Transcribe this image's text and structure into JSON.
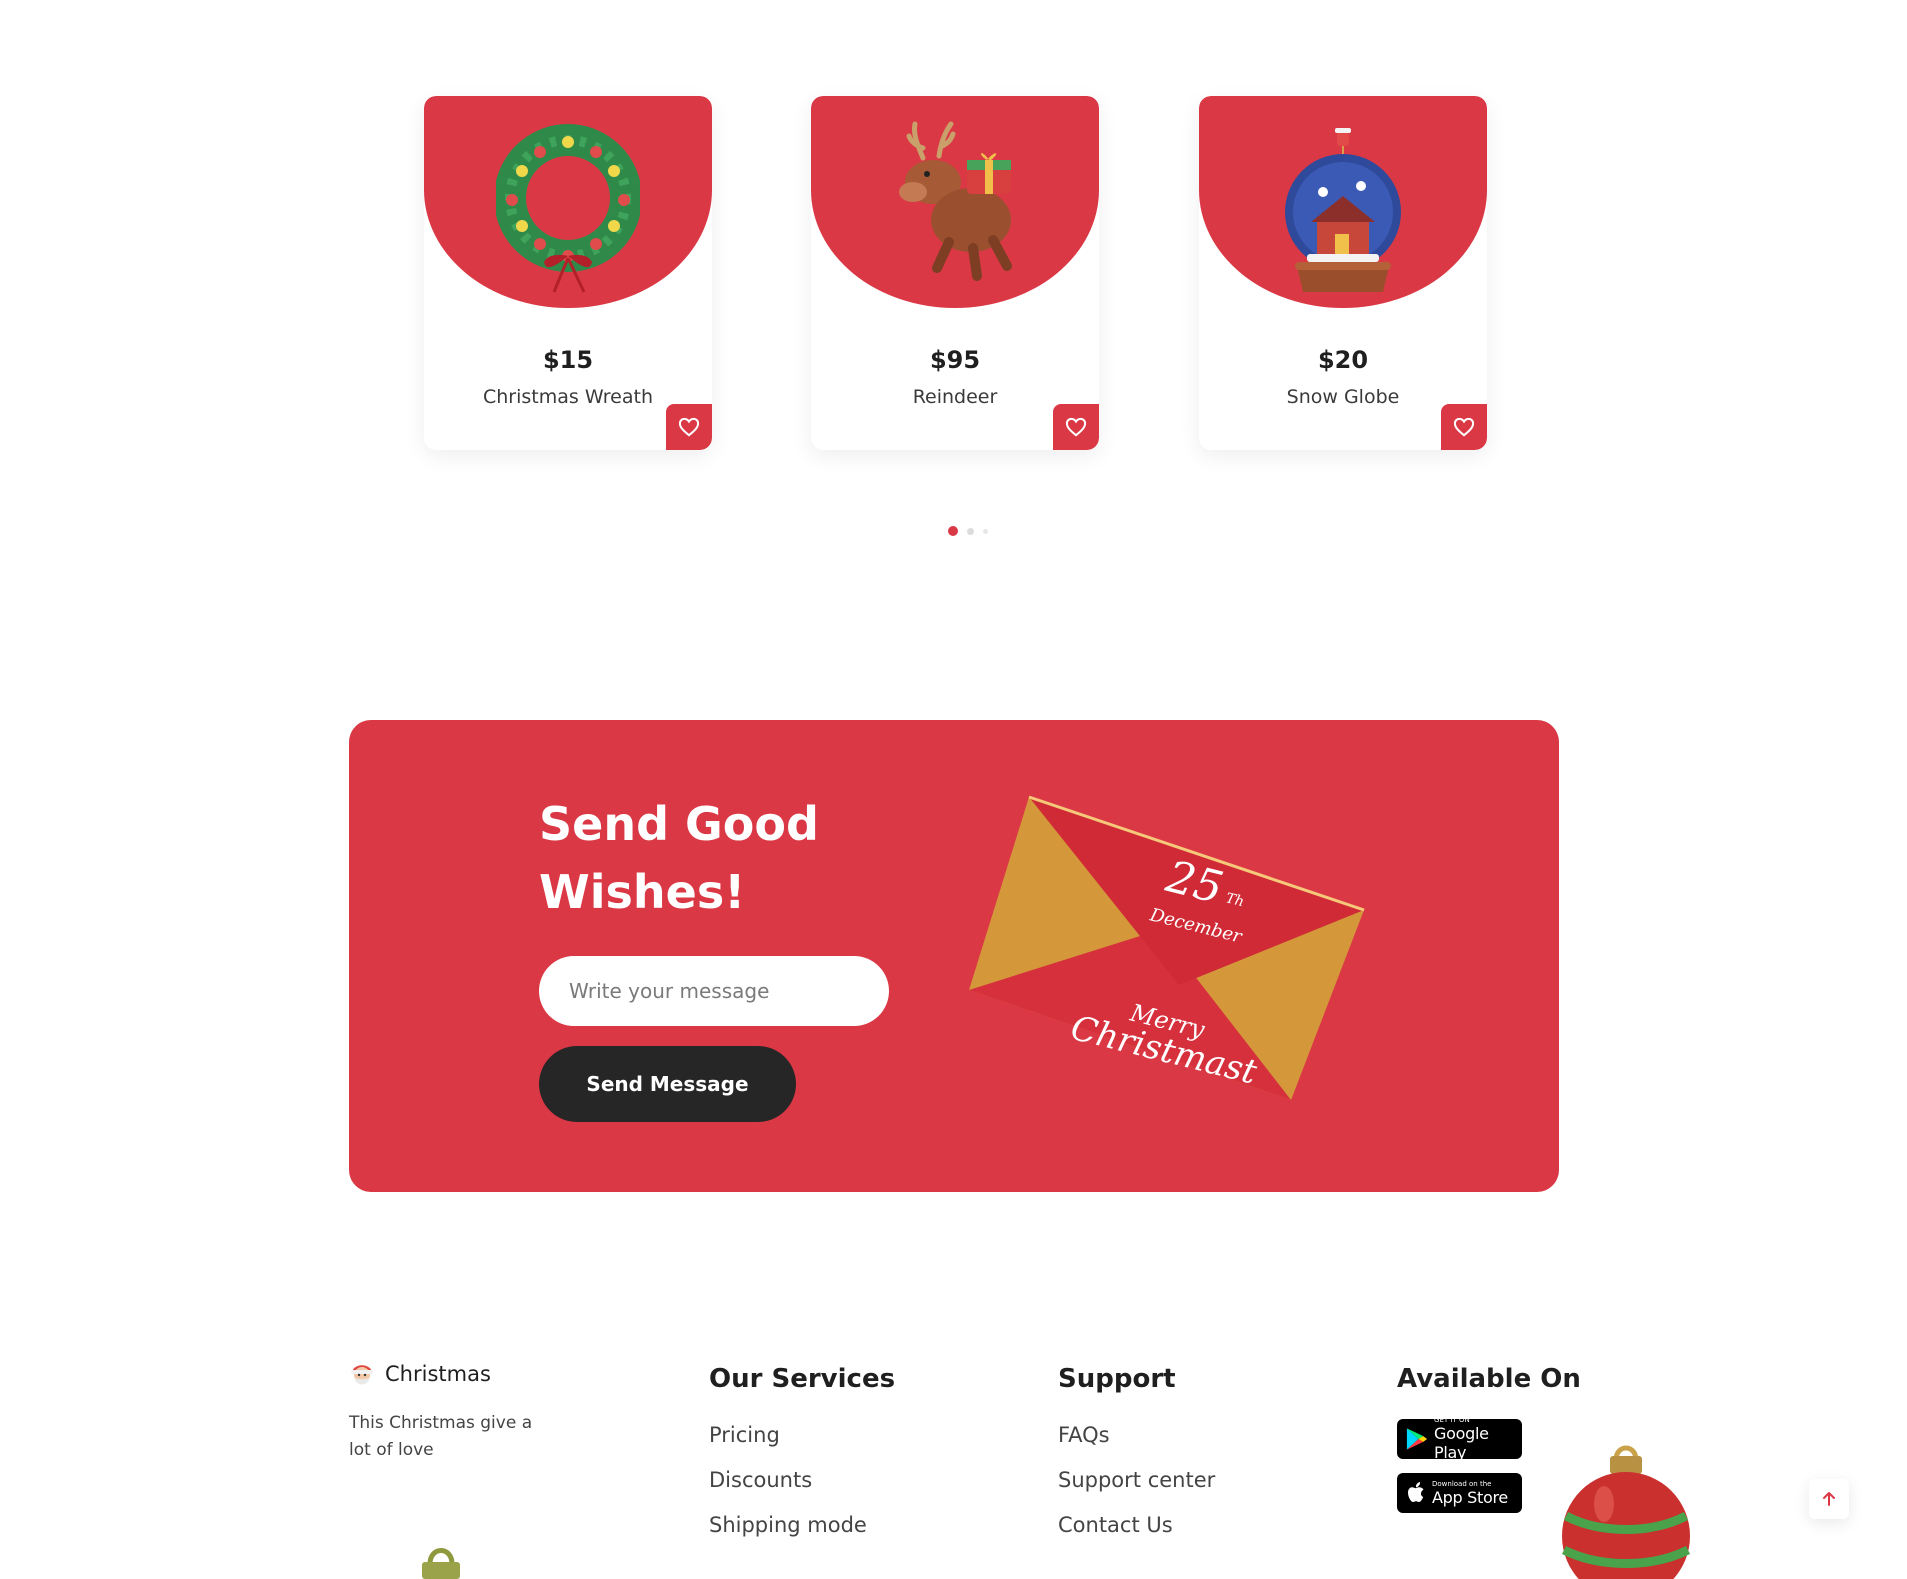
{
  "products": [
    {
      "price": "$15",
      "name": "Christmas Wreath",
      "image": "christmas-wreath-image",
      "favorite_icon": "heart-icon"
    },
    {
      "price": "$95",
      "name": "Reindeer",
      "image": "reindeer-image",
      "favorite_icon": "heart-icon"
    },
    {
      "price": "$20",
      "name": "Snow Globe",
      "image": "snow-globe-image",
      "favorite_icon": "heart-icon"
    }
  ],
  "carousel": {
    "pages": 3,
    "active_page": 1
  },
  "wishes": {
    "title": "Send Good Wishes!",
    "input_placeholder": "Write your message",
    "input_value": "",
    "button_label": "Send Message",
    "envelope_text": {
      "day": "25",
      "suffix": "Th",
      "month": "December",
      "greeting_1": "Merry",
      "greeting_2": "Christmast"
    }
  },
  "footer": {
    "brand": {
      "icon": "santa-icon",
      "name": "Christmas",
      "tagline": "This Christmas give a lot of love"
    },
    "services": {
      "title": "Our Services",
      "links": [
        "Pricing",
        "Discounts",
        "Shipping mode"
      ]
    },
    "support": {
      "title": "Support",
      "links": [
        "FAQs",
        "Support center",
        "Contact Us"
      ]
    },
    "available": {
      "title": "Available On",
      "google_play": {
        "small": "GET IT ON",
        "big": "Google Play"
      },
      "app_store": {
        "small": "Download on the",
        "big": "App Store"
      }
    }
  },
  "scroll_top_icon": "arrow-up-icon",
  "colors": {
    "accent": "#db3845",
    "dark": "#262626",
    "gold": "#d4983a"
  }
}
